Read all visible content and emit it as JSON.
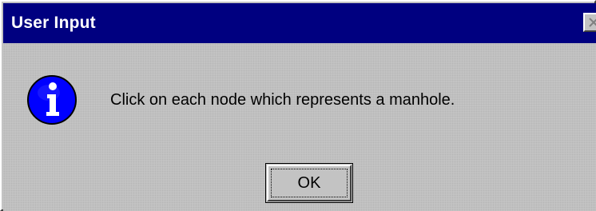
{
  "dialog": {
    "title": "User Input",
    "message": "Click on each node which represents a manhole.",
    "ok_label": "OK",
    "icon": "info-icon",
    "close_icon": "close-icon"
  },
  "colors": {
    "titlebar": "#000080",
    "title_text": "#ffffff",
    "face": "#c3c3c3",
    "icon_fill": "#0000ff"
  }
}
